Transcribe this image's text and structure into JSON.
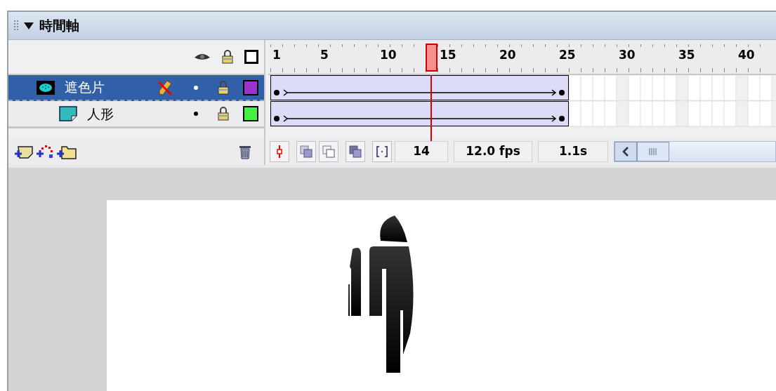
{
  "panel": {
    "title": "時間軸",
    "expanded": true
  },
  "ruler": [
    "1",
    "5",
    "10",
    "15",
    "20",
    "25",
    "30",
    "35",
    "40"
  ],
  "layers": [
    {
      "name": "遮色片",
      "kind": "mask",
      "selected": true,
      "locked": true,
      "color": "#9933cc",
      "level": 0.5952
    },
    {
      "name": "人形",
      "kind": "masked",
      "selected": false,
      "locked": true,
      "color": "#44ee44",
      "level": 0.5952
    }
  ],
  "status": {
    "current_frame": "14",
    "fps": "12.0 fps",
    "time": "1.1s"
  }
}
